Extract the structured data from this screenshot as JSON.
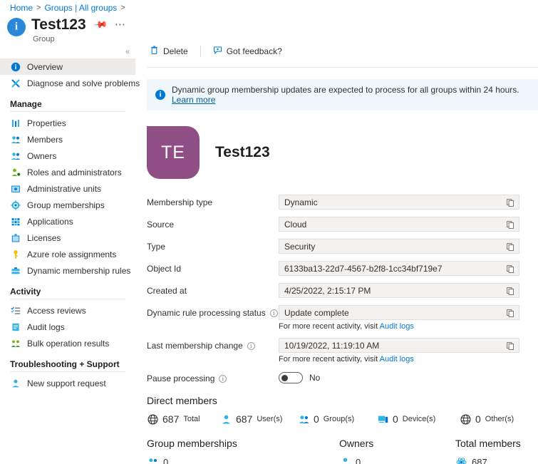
{
  "breadcrumb": {
    "items": [
      "Home",
      "Groups | All groups"
    ],
    "separator": ">"
  },
  "header": {
    "title": "Test123",
    "subtitle": "Group",
    "pin_title": "Pin to dashboard",
    "more_title": "More"
  },
  "sidebar": {
    "top_items": [
      {
        "label": "Overview",
        "icon": "info-circle-icon",
        "selected": true
      },
      {
        "label": "Diagnose and solve problems",
        "icon": "wrench-icon",
        "selected": false
      }
    ],
    "manage_header": "Manage",
    "manage_items": [
      {
        "label": "Properties",
        "icon": "properties-icon"
      },
      {
        "label": "Members",
        "icon": "members-icon"
      },
      {
        "label": "Owners",
        "icon": "owners-icon"
      },
      {
        "label": "Roles and administrators",
        "icon": "roles-icon"
      },
      {
        "label": "Administrative units",
        "icon": "admin-units-icon"
      },
      {
        "label": "Group memberships",
        "icon": "group-memberships-icon"
      },
      {
        "label": "Applications",
        "icon": "applications-grid-icon"
      },
      {
        "label": "Licenses",
        "icon": "licenses-icon"
      },
      {
        "label": "Azure role assignments",
        "icon": "key-icon"
      },
      {
        "label": "Dynamic membership rules",
        "icon": "dynamic-rules-icon"
      }
    ],
    "activity_header": "Activity",
    "activity_items": [
      {
        "label": "Access reviews",
        "icon": "access-reviews-icon"
      },
      {
        "label": "Audit logs",
        "icon": "audit-logs-icon"
      },
      {
        "label": "Bulk operation results",
        "icon": "bulk-operations-icon"
      }
    ],
    "support_header": "Troubleshooting + Support",
    "support_items": [
      {
        "label": "New support request",
        "icon": "support-person-icon"
      }
    ],
    "collapse_glyph": "«"
  },
  "toolbar": {
    "delete_label": "Delete",
    "feedback_label": "Got feedback?"
  },
  "banner": {
    "text": "Dynamic group membership updates are expected to process for all groups within 24 hours.",
    "link": "Learn more"
  },
  "group": {
    "initials": "TE",
    "name": "Test123",
    "avatar_color": "#8f4f85"
  },
  "properties": [
    {
      "label": "Membership type",
      "value": "Dynamic",
      "info": false
    },
    {
      "label": "Source",
      "value": "Cloud",
      "info": false
    },
    {
      "label": "Type",
      "value": "Security",
      "info": false
    },
    {
      "label": "Object Id",
      "value": "6133ba13-22d7-4567-b2f8-1cc34bf719e7",
      "info": false
    },
    {
      "label": "Created at",
      "value": "4/25/2022, 2:15:17 PM",
      "info": false
    },
    {
      "label": "Dynamic rule processing status",
      "value": "Update complete",
      "info": true,
      "note_prefix": "For more recent activity, visit ",
      "note_link": "Audit logs"
    },
    {
      "label": "Last membership change",
      "value": "10/19/2022, 11:19:10 AM",
      "info": true,
      "note_prefix": "For more recent activity, visit ",
      "note_link": "Audit logs"
    }
  ],
  "pause_processing": {
    "label": "Pause processing",
    "state": "No",
    "enabled": false
  },
  "direct_members": {
    "heading": "Direct members",
    "stats": [
      {
        "count": "687",
        "unit": "Total",
        "icon": "globe-icon"
      },
      {
        "count": "687",
        "unit": "User(s)",
        "icon": "user-icon"
      },
      {
        "count": "0",
        "unit": "Group(s)",
        "icon": "group-icon"
      },
      {
        "count": "0",
        "unit": "Device(s)",
        "icon": "device-icon"
      },
      {
        "count": "0",
        "unit": "Other(s)",
        "icon": "globe-icon"
      }
    ]
  },
  "summary_columns": [
    {
      "heading": "Group memberships",
      "value": "0",
      "icon": "group-icon"
    },
    {
      "heading": "Owners",
      "value": "0",
      "icon": "user-icon"
    },
    {
      "heading": "Total members",
      "value": "687",
      "icon": "atom-icon"
    }
  ],
  "copy_button_title": "Copy to clipboard"
}
